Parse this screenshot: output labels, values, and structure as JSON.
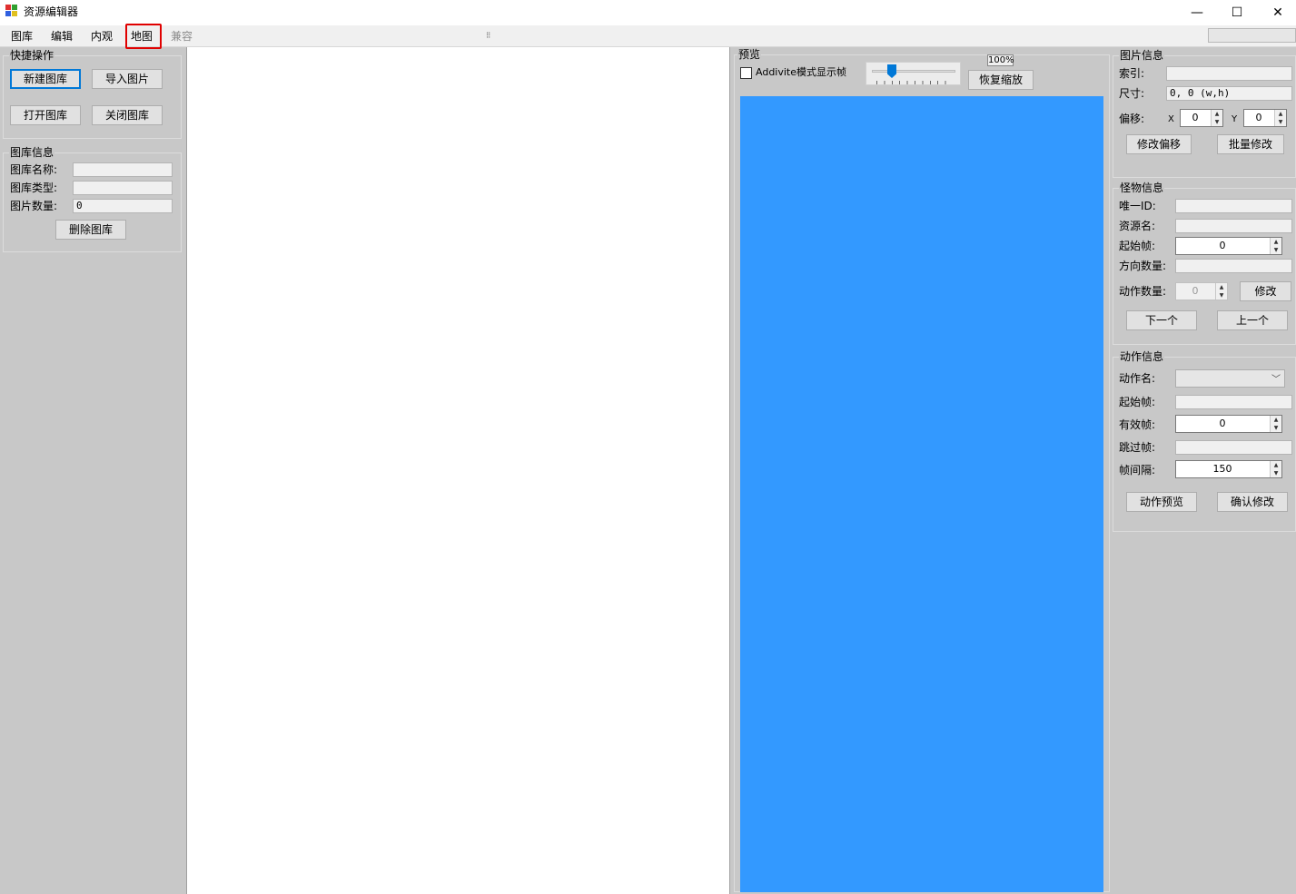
{
  "window": {
    "title": "资源编辑器",
    "minimize_glyph": "—",
    "maximize_glyph": "☐",
    "close_glyph": "✕"
  },
  "menu": {
    "items": [
      {
        "label": "图库"
      },
      {
        "label": "编辑"
      },
      {
        "label": "内观"
      },
      {
        "label": "地图"
      },
      {
        "label": "兼容"
      }
    ]
  },
  "quick_ops": {
    "title": "快捷操作",
    "new_library": "新建图库",
    "import_image": "导入图片",
    "open_library": "打开图库",
    "close_library": "关闭图库"
  },
  "library_info": {
    "title": "图库信息",
    "name_label": "图库名称:",
    "name_value": "",
    "type_label": "图库类型:",
    "type_value": "",
    "count_label": "图片数量:",
    "count_value": "0",
    "delete_button": "删除图库"
  },
  "preview": {
    "title": "预览",
    "additive_label": "Addivite模式显示帧",
    "zoom_value": "100%",
    "reset_zoom": "恢复缩放",
    "slider_level": 0.2,
    "canvas_color": "#3399ff"
  },
  "image_info": {
    "title": "图片信息",
    "index_label": "索引:",
    "index_value": "",
    "size_label": "尺寸:",
    "size_value": "0, 0 (w,h)",
    "offset_label": "偏移:",
    "x_label": "X",
    "x_value": "0",
    "y_label": "Y",
    "y_value": "0",
    "modify_offset": "修改偏移",
    "batch_modify": "批量修改"
  },
  "monster_info": {
    "title": "怪物信息",
    "uid_label": "唯一ID:",
    "resname_label": "资源名:",
    "start_frame_label": "起始帧:",
    "start_frame_value": "0",
    "direction_count_label": "方向数量:",
    "action_count_label": "动作数量:",
    "action_count_value": "0",
    "modify_button": "修改",
    "next_button": "下一个",
    "prev_button": "上一个"
  },
  "action_info": {
    "title": "动作信息",
    "action_name_label": "动作名:",
    "start_frame_label": "起始帧:",
    "valid_frames_label": "有效帧:",
    "valid_frames_value": "0",
    "skip_frames_label": "跳过帧:",
    "interval_label": "帧间隔:",
    "interval_value": "150",
    "preview_button": "动作预览",
    "confirm_button": "确认修改"
  },
  "colors": {
    "highlight": "#e00000",
    "accent": "#0078d7",
    "panel_bg": "#c8c8c8"
  }
}
